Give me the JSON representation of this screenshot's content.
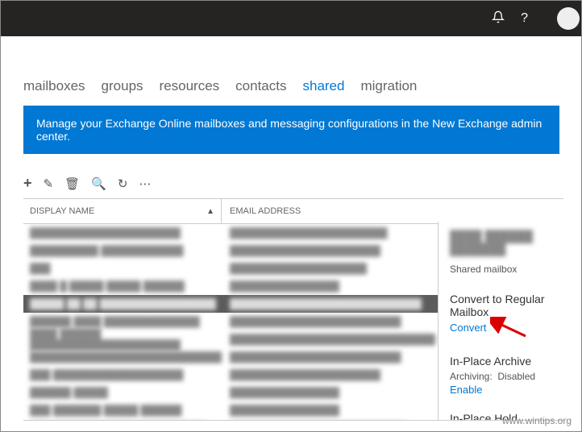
{
  "topbar": {
    "notif_icon": "🔔",
    "help_icon": "?"
  },
  "tabs": [
    {
      "label": "mailboxes",
      "active": false
    },
    {
      "label": "groups",
      "active": false
    },
    {
      "label": "resources",
      "active": false
    },
    {
      "label": "contacts",
      "active": false
    },
    {
      "label": "shared",
      "active": true
    },
    {
      "label": "migration",
      "active": false
    }
  ],
  "banner": {
    "text": "Manage your Exchange Online mailboxes and messaging configurations in the New Exchange admin center."
  },
  "toolbar": {
    "add": "+",
    "edit": "✎",
    "delete": "🗑",
    "search": "🔍",
    "refresh": "↻",
    "more": "⋯"
  },
  "columns": {
    "name": "DISPLAY NAME",
    "sort": "▲",
    "email": "EMAIL ADDRESS"
  },
  "rows": [
    {
      "name": "██████████████████████",
      "email": "███████████████████████",
      "selected": false
    },
    {
      "name": "██████████ ████████████",
      "email": "██████████████████████",
      "selected": false
    },
    {
      "name": "███",
      "email": "████████████████████",
      "selected": false
    },
    {
      "name": "████ █ █████ █████ ██████",
      "email": "████████████████",
      "selected": false
    },
    {
      "name": "█████ ██ ██ █████████████████",
      "email": "████████████████████████████",
      "selected": true
    },
    {
      "name": "██████ ████ ██████████████",
      "email": "█████████████████████████",
      "selected": false
    },
    {
      "name": "████ ██████ ██████████████████████",
      "email": "██████████████████████████████",
      "selected": false
    },
    {
      "name": "████████████████████████████",
      "email": "█████████████████████████",
      "selected": false
    },
    {
      "name": "███ ███████████████████",
      "email": "██████████████████████",
      "selected": false
    },
    {
      "name": "██████ █████",
      "email": "████████████████",
      "selected": false
    },
    {
      "name": "███ ███████ █████ ██████",
      "email": "████████████████",
      "selected": false
    },
    {
      "name": "██████████████████████████",
      "email": "██████████████████████████",
      "selected": false
    }
  ],
  "side": {
    "title": "████ ██████ ███████",
    "type": "Shared mailbox",
    "convert_heading": "Convert to Regular Mailbox",
    "convert_link": "Convert",
    "archive_heading": "In-Place Archive",
    "archive_label": "Archiving:",
    "archive_value": "Disabled",
    "enable_link": "Enable",
    "hold_heading": "In-Place Hold"
  },
  "watermark": "www.wintips.org"
}
